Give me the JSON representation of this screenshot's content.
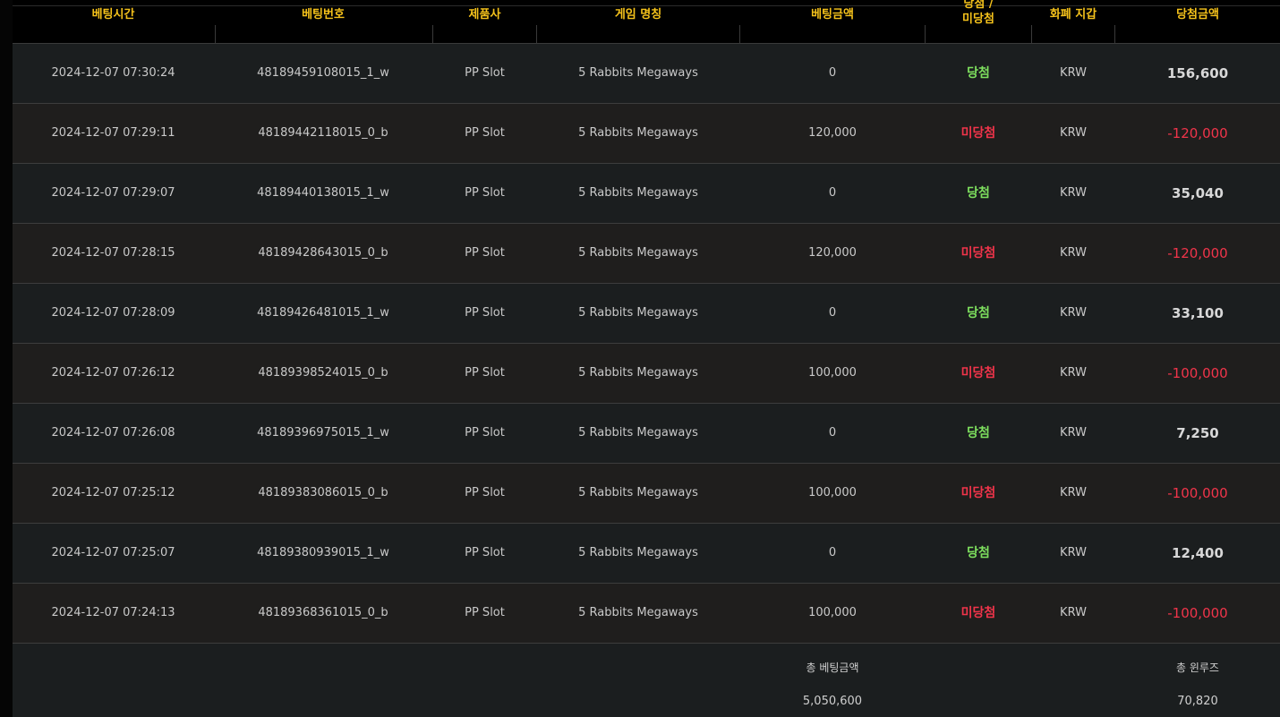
{
  "colors": {
    "header_text": "#f5c21b",
    "win": "#7ee05e",
    "lose": "#f0344a",
    "negative_amount": "#f0344a",
    "positive_amount": "#d8d8d8"
  },
  "header": {
    "bet_time": "베팅시간",
    "bet_number": "베팅번호",
    "provider": "제품사",
    "game_name": "게임 명칭",
    "bet_amount": "베팅금액",
    "result_line1": "당첨 /",
    "result_line2": "미당첨",
    "currency_wallet": "화폐 지갑",
    "win_amount": "당첨금액"
  },
  "rows": [
    {
      "time": "2024-12-07 07:30:24",
      "bet_id": "48189459108015_1_w",
      "provider": "PP Slot",
      "game": "5 Rabbits Megaways",
      "bet": "0",
      "result": "당첨",
      "result_type": "win",
      "currency": "KRW",
      "amount": "156,600",
      "amount_type": "positive"
    },
    {
      "time": "2024-12-07 07:29:11",
      "bet_id": "48189442118015_0_b",
      "provider": "PP Slot",
      "game": "5 Rabbits Megaways",
      "bet": "120,000",
      "result": "미당첨",
      "result_type": "lose",
      "currency": "KRW",
      "amount": "-120,000",
      "amount_type": "negative"
    },
    {
      "time": "2024-12-07 07:29:07",
      "bet_id": "48189440138015_1_w",
      "provider": "PP Slot",
      "game": "5 Rabbits Megaways",
      "bet": "0",
      "result": "당첨",
      "result_type": "win",
      "currency": "KRW",
      "amount": "35,040",
      "amount_type": "positive"
    },
    {
      "time": "2024-12-07 07:28:15",
      "bet_id": "48189428643015_0_b",
      "provider": "PP Slot",
      "game": "5 Rabbits Megaways",
      "bet": "120,000",
      "result": "미당첨",
      "result_type": "lose",
      "currency": "KRW",
      "amount": "-120,000",
      "amount_type": "negative"
    },
    {
      "time": "2024-12-07 07:28:09",
      "bet_id": "48189426481015_1_w",
      "provider": "PP Slot",
      "game": "5 Rabbits Megaways",
      "bet": "0",
      "result": "당첨",
      "result_type": "win",
      "currency": "KRW",
      "amount": "33,100",
      "amount_type": "positive"
    },
    {
      "time": "2024-12-07 07:26:12",
      "bet_id": "48189398524015_0_b",
      "provider": "PP Slot",
      "game": "5 Rabbits Megaways",
      "bet": "100,000",
      "result": "미당첨",
      "result_type": "lose",
      "currency": "KRW",
      "amount": "-100,000",
      "amount_type": "negative"
    },
    {
      "time": "2024-12-07 07:26:08",
      "bet_id": "48189396975015_1_w",
      "provider": "PP Slot",
      "game": "5 Rabbits Megaways",
      "bet": "0",
      "result": "당첨",
      "result_type": "win",
      "currency": "KRW",
      "amount": "7,250",
      "amount_type": "positive"
    },
    {
      "time": "2024-12-07 07:25:12",
      "bet_id": "48189383086015_0_b",
      "provider": "PP Slot",
      "game": "5 Rabbits Megaways",
      "bet": "100,000",
      "result": "미당첨",
      "result_type": "lose",
      "currency": "KRW",
      "amount": "-100,000",
      "amount_type": "negative"
    },
    {
      "time": "2024-12-07 07:25:07",
      "bet_id": "48189380939015_1_w",
      "provider": "PP Slot",
      "game": "5 Rabbits Megaways",
      "bet": "0",
      "result": "당첨",
      "result_type": "win",
      "currency": "KRW",
      "amount": "12,400",
      "amount_type": "positive"
    },
    {
      "time": "2024-12-07 07:24:13",
      "bet_id": "48189368361015_0_b",
      "provider": "PP Slot",
      "game": "5 Rabbits Megaways",
      "bet": "100,000",
      "result": "미당첨",
      "result_type": "lose",
      "currency": "KRW",
      "amount": "-100,000",
      "amount_type": "negative"
    }
  ],
  "summary": {
    "total_bet_label": "총 베팅금액",
    "total_bet_value": "5,050,600",
    "total_winloss_label": "총 윈루즈",
    "total_winloss_value": "70,820"
  }
}
